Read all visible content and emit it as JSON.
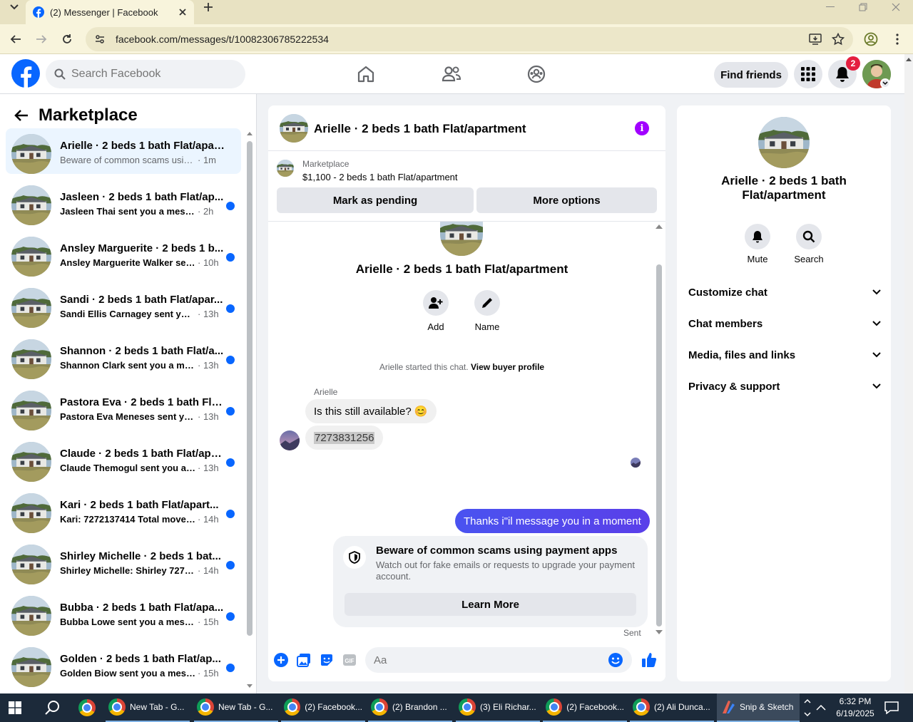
{
  "browser": {
    "tab_title": "(2) Messenger | Facebook",
    "url": "facebook.com/messages/t/10082306785222534",
    "icons": [
      "tab-dropdown-icon",
      "facebook-favicon",
      "close-icon",
      "plus-icon",
      "minimize-icon",
      "restore-icon",
      "close-window-icon",
      "back-icon",
      "forward-icon",
      "reload-icon",
      "site-info-icon",
      "install-icon",
      "star-icon",
      "profile-icon",
      "kebab-icon"
    ]
  },
  "fb": {
    "search_placeholder": "Search Facebook",
    "find_friends": "Find friends",
    "notifications_count": "2",
    "brand_color": "#0866ff"
  },
  "left": {
    "title": "Marketplace",
    "conversations": [
      {
        "name": "Arielle · 2 beds 1 bath Flat/apart...",
        "preview": "Beware of common scams using p...",
        "time": "· 1m",
        "unread": false,
        "active": true
      },
      {
        "name": "Jasleen · 2 beds 1 bath Flat/ap...",
        "preview": "Jasleen Thai sent you a message...",
        "time": "· 2h",
        "unread": true
      },
      {
        "name": "Ansley Marguerite · 2 beds 1 b...",
        "preview": "Ansley Marguerite Walker sent ...",
        "time": "· 10h",
        "unread": true
      },
      {
        "name": "Sandi · 2 beds 1 bath Flat/apar...",
        "preview": "Sandi Ellis Carnagey sent you a...",
        "time": "· 13h",
        "unread": true
      },
      {
        "name": "Shannon · 2 beds 1 bath Flat/a...",
        "preview": "Shannon Clark sent you a mess...",
        "time": "· 13h",
        "unread": true
      },
      {
        "name": "Pastora Eva · 2 beds 1 bath Flat...",
        "preview": "Pastora Eva Meneses sent you ...",
        "time": "· 13h",
        "unread": true
      },
      {
        "name": "Claude · 2 beds 1 bath Flat/apa...",
        "preview": "Claude Themogul sent you a m...",
        "time": "· 13h",
        "unread": true
      },
      {
        "name": "Kari · 2 beds 1 bath Flat/apart...",
        "preview": "Kari: 7272137414 Total move in...",
        "time": "· 14h",
        "unread": true
      },
      {
        "name": "Shirley Michelle · 2 beds 1 bat...",
        "preview": "Shirley Michelle: Shirley 727-3...",
        "time": "· 14h",
        "unread": true
      },
      {
        "name": "Bubba · 2 beds 1 bath Flat/apa...",
        "preview": "Bubba Lowe sent you a messa...",
        "time": "· 15h",
        "unread": true
      },
      {
        "name": "Golden · 2 beds 1 bath Flat/ap...",
        "preview": "Golden Biow sent you a messa...",
        "time": "· 15h",
        "unread": true
      }
    ]
  },
  "chat": {
    "title": "Arielle · 2 beds 1 bath Flat/apartment",
    "marketplace_label": "Marketplace",
    "listing": "$1,100 - 2 beds 1 bath Flat/apartment",
    "mark_pending": "Mark as pending",
    "more_options": "More options",
    "profile_title": "Arielle · 2 beds 1 bath Flat/apartment",
    "add_label": "Add",
    "name_label": "Name",
    "started_text": "Arielle started this chat.",
    "view_buyer": "View buyer profile",
    "sender": "Arielle",
    "msg1": "Is this still available? 😊",
    "msg2": "7273831256",
    "msg_out": "Thanks i\"il message you in a moment",
    "scam_title": "Beware of common scams using payment apps",
    "scam_text": "Watch out for fake emails or requests to upgrade your payment account.",
    "learn_more": "Learn More",
    "sent": "Sent",
    "composer_placeholder": "Aa",
    "outgoing_color": "#5046ef"
  },
  "right": {
    "title": "Arielle · 2 beds 1 bath Flat/apartment",
    "mute": "Mute",
    "search": "Search",
    "sections": [
      "Customize chat",
      "Chat members",
      "Media, files and links",
      "Privacy & support"
    ]
  },
  "taskbar": {
    "items": [
      {
        "label": "New Tab - G..."
      },
      {
        "label": "New Tab - G..."
      },
      {
        "label": "(2) Facebook..."
      },
      {
        "label": "(2) Brandon ..."
      },
      {
        "label": "(3) Eli Richar..."
      },
      {
        "label": "(2) Facebook..."
      },
      {
        "label": "(2) Ali Dunca..."
      },
      {
        "label": "Snip & Sketch"
      }
    ],
    "time": "6:32 PM",
    "date": "6/19/2025"
  }
}
